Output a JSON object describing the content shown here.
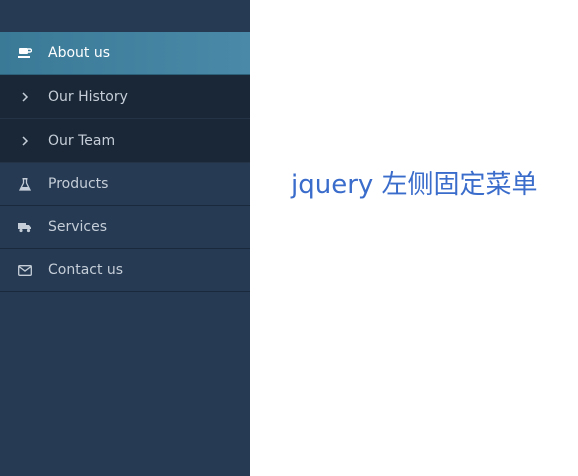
{
  "sidebar": {
    "items": [
      {
        "label": "About us",
        "icon": "coffee-cup-icon",
        "active": true
      },
      {
        "label": "Our History",
        "icon": "chevron-right-icon",
        "sub": true
      },
      {
        "label": "Our Team",
        "icon": "chevron-right-icon",
        "sub": true
      },
      {
        "label": "Products",
        "icon": "flask-icon"
      },
      {
        "label": "Services",
        "icon": "truck-icon"
      },
      {
        "label": "Contact us",
        "icon": "envelope-icon"
      }
    ]
  },
  "main": {
    "title": "jquery 左侧固定菜单"
  },
  "colors": {
    "sidebar_bg": "#263a53",
    "active_bg": "#3f7f9c",
    "submenu_bg": "#1a2737",
    "title_color": "#3a6ccb"
  }
}
